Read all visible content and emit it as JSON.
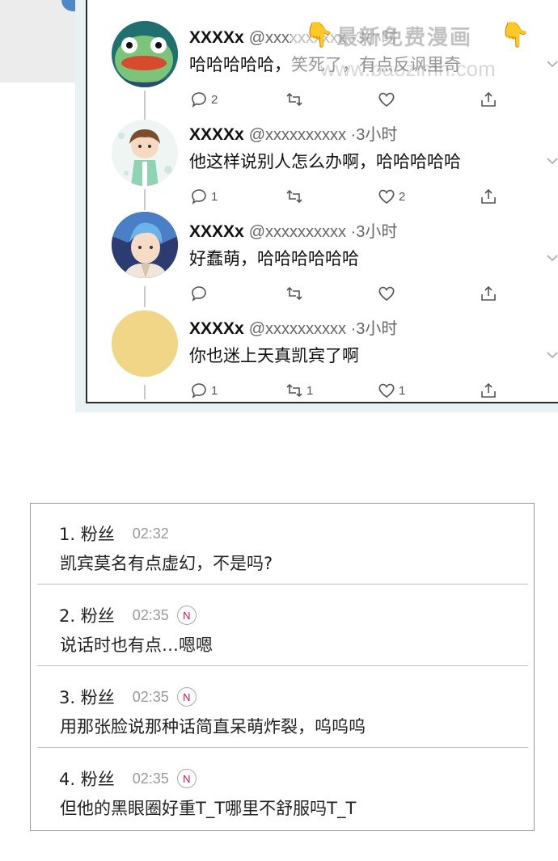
{
  "watermark": {
    "title": "最新免费漫画",
    "url": "www.baozimh.com",
    "hand_icon": "pointing-hand-icon"
  },
  "tweets": [
    {
      "name": "XXXXx",
      "handle": "@xxxxxxxxxx ·3小时",
      "text": "哈哈哈哈哈，笑死了，有点反讽里奇",
      "replies": "2",
      "retweets": "",
      "likes": "",
      "avatar": "green-character-avatar"
    },
    {
      "name": "XXXXx",
      "handle": "@xxxxxxxxxx ·3小时",
      "text": "他这样说别人怎么办啊，哈哈哈哈哈",
      "replies": "1",
      "retweets": "",
      "likes": "2",
      "avatar": "boy-chibi-avatar"
    },
    {
      "name": "XXXXx",
      "handle": "@xxxxxxxxxx ·3小时",
      "text": "好蠢萌，哈哈哈哈哈哈",
      "replies": "",
      "retweets": "",
      "likes": "",
      "avatar": "anime-boy-avatar"
    },
    {
      "name": "XXXXx",
      "handle": "@xxxxxxxxxx ·3小时",
      "text": "你也迷上天真凯宾了啊",
      "replies": "1",
      "retweets": "1",
      "likes": "1",
      "avatar": "yellow-circle-avatar"
    }
  ],
  "comments": [
    {
      "user": "1. 粉丝",
      "time": "02:32",
      "badge": "",
      "text": "凯宾莫名有点虚幻，不是吗?"
    },
    {
      "user": "2. 粉丝",
      "time": "02:35",
      "badge": "N",
      "text": "说话时也有点…嗯嗯"
    },
    {
      "user": "3. 粉丝",
      "time": "02:35",
      "badge": "N",
      "text": "用那张脸说那种话简直呆萌炸裂，呜呜呜"
    },
    {
      "user": "4. 粉丝",
      "time": "02:35",
      "badge": "N",
      "text": "但他的黑眼圈好重T_T哪里不舒服吗T_T"
    }
  ],
  "colors": {
    "avatar_yellow": "#f0d686",
    "badge_n": "#c2185b",
    "panel_border": "#2a2a2a",
    "watermark_hand": "#f2b400"
  }
}
